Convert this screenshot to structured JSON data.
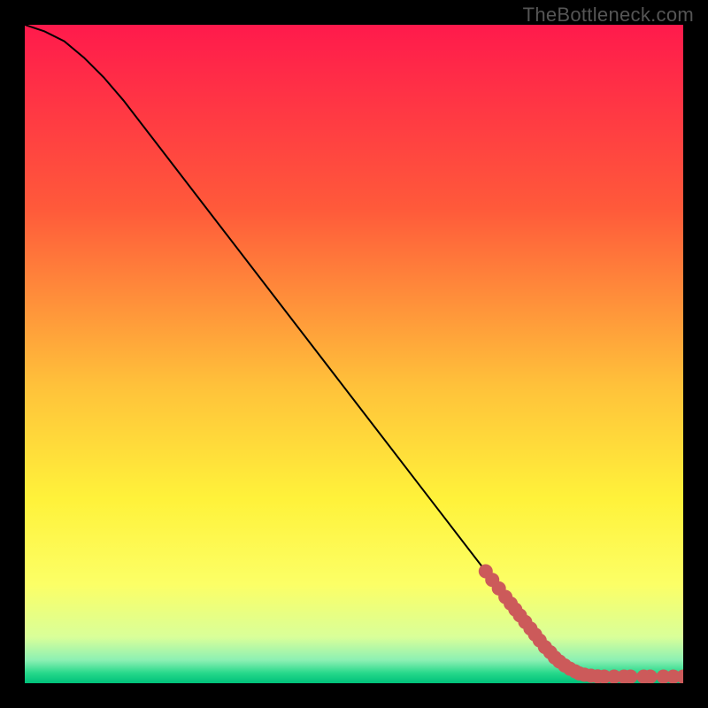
{
  "watermark": "TheBottleneck.com",
  "colors": {
    "gradient_stops": [
      {
        "offset": 0.0,
        "color": "#ff1a4c"
      },
      {
        "offset": 0.28,
        "color": "#ff5a3a"
      },
      {
        "offset": 0.55,
        "color": "#ffc23a"
      },
      {
        "offset": 0.72,
        "color": "#fff23a"
      },
      {
        "offset": 0.85,
        "color": "#fcff66"
      },
      {
        "offset": 0.93,
        "color": "#d9ff99"
      },
      {
        "offset": 0.965,
        "color": "#8cf0b3"
      },
      {
        "offset": 0.985,
        "color": "#25d88a"
      },
      {
        "offset": 1.0,
        "color": "#00c07a"
      }
    ],
    "line": "#000000",
    "marker": "#cc5a5a"
  },
  "chart_data": {
    "type": "line",
    "title": "",
    "xlabel": "",
    "ylabel": "",
    "xlim": [
      0,
      100
    ],
    "ylim": [
      0,
      100
    ],
    "series": [
      {
        "name": "curve",
        "x": [
          0,
          3,
          6,
          9,
          12,
          15,
          20,
          30,
          40,
          50,
          60,
          70,
          78,
          82,
          85,
          88,
          92,
          96,
          100
        ],
        "y": [
          100,
          99,
          97.5,
          95,
          92,
          88.5,
          82,
          69,
          56,
          43,
          30,
          17,
          6,
          2.5,
          1.3,
          1.0,
          1.0,
          1.0,
          1.0
        ]
      }
    ],
    "markers": {
      "name": "highlighted-points",
      "x": [
        70,
        71,
        72,
        73,
        73.8,
        74.5,
        75.2,
        76,
        76.8,
        77.5,
        78.2,
        79,
        79.8,
        80.5,
        81.2,
        82,
        82.8,
        83.6,
        84.2,
        85,
        86,
        87,
        88,
        89.5,
        91,
        92,
        94,
        95,
        97,
        98.5,
        100
      ],
      "y": [
        17,
        15.7,
        14.4,
        13.1,
        12.1,
        11.2,
        10.3,
        9.3,
        8.3,
        7.4,
        6.5,
        5.5,
        4.7,
        3.9,
        3.3,
        2.7,
        2.2,
        1.8,
        1.5,
        1.3,
        1.15,
        1.05,
        1.0,
        1.0,
        1.0,
        1.0,
        1.0,
        1.0,
        1.0,
        1.0,
        1.0
      ]
    }
  }
}
